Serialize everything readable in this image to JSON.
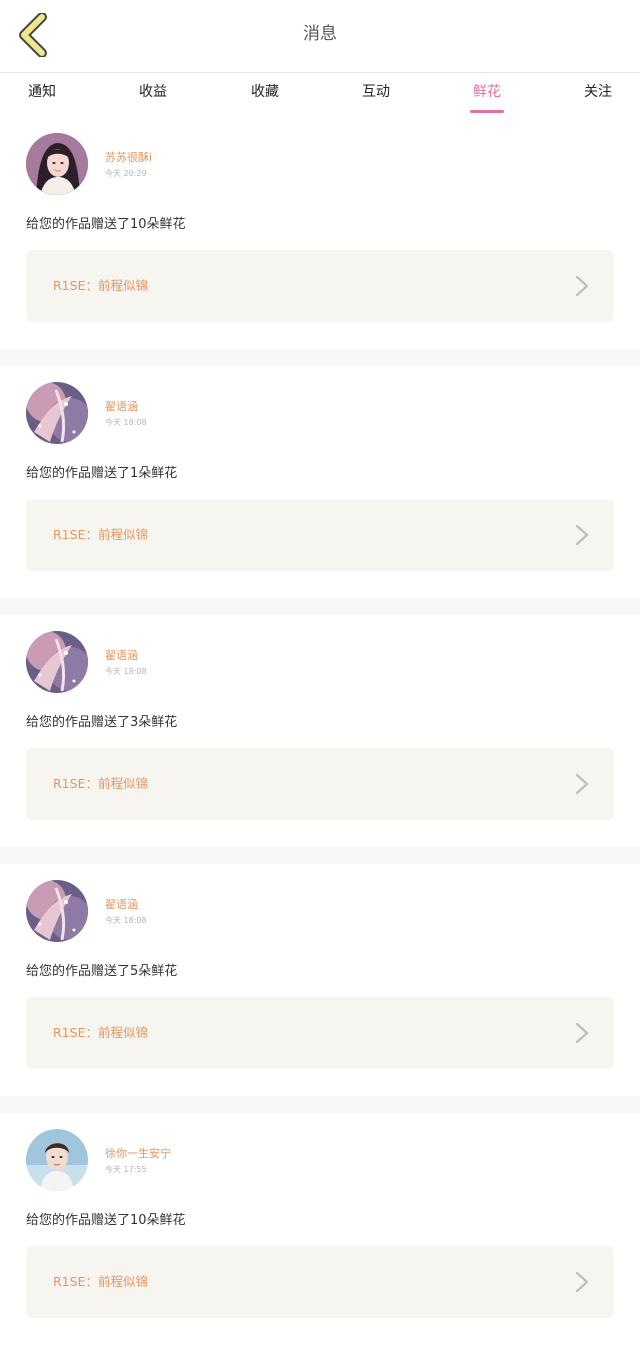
{
  "header": {
    "title": "消息"
  },
  "tabs": [
    {
      "label": "通知",
      "active": false
    },
    {
      "label": "收益",
      "active": false
    },
    {
      "label": "收藏",
      "active": false
    },
    {
      "label": "互动",
      "active": false
    },
    {
      "label": "鲜花",
      "active": true
    },
    {
      "label": "关注",
      "active": false
    }
  ],
  "notifications": [
    {
      "username": "苏苏很酥i",
      "time": "今天 20:29",
      "message": "给您的作品赠送了10朵鲜花",
      "work_title": "R1SE：前程似锦",
      "avatar": "portrait-girl"
    },
    {
      "username": "翟语涵",
      "time": "今天 18:08",
      "message": "给您的作品赠送了1朵鲜花",
      "work_title": "R1SE：前程似锦",
      "avatar": "anime-pink"
    },
    {
      "username": "翟语涵",
      "time": "今天 18:08",
      "message": "给您的作品赠送了3朵鲜花",
      "work_title": "R1SE：前程似锦",
      "avatar": "anime-pink"
    },
    {
      "username": "翟语涵",
      "time": "今天 18:08",
      "message": "给您的作品赠送了5朵鲜花",
      "work_title": "R1SE：前程似锦",
      "avatar": "anime-pink"
    },
    {
      "username": "徐你一生安宁",
      "time": "今天 17:55",
      "message": "给您的作品赠送了10朵鲜花",
      "work_title": "R1SE：前程似锦",
      "avatar": "portrait-boy"
    }
  ],
  "colors": {
    "accent_pink": "#e56fa3",
    "name_orange": "#e8955f",
    "back_icon_yellow": "#f0e68c",
    "card_bg": "#f6f5ef",
    "separator": "#f7f7f7"
  }
}
